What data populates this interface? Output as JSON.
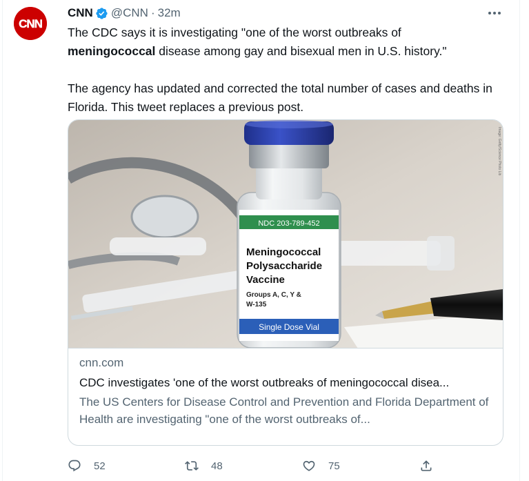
{
  "tweet": {
    "display_name": "CNN",
    "handle": "@CNN",
    "separator": "·",
    "time": "32m",
    "avatar_text": "CNN",
    "text_line1": "The CDC says it is investigating \"one of the worst outbreaks of",
    "text_highlight": "meningococcal",
    "text_line2_rest": " disease among gay and bisexual men in U.S. history.\"",
    "text_paragraph2": "The agency has updated and corrected the total number of cases and deaths in Florida. This tweet replaces a previous post."
  },
  "card": {
    "domain": "cnn.com",
    "title": "CDC investigates 'one of the worst outbreaks of meningococcal disea...",
    "description": "The US Centers for Disease Control and Prevention and Florida Department of Health are investigating \"one of the worst outbreaks of...",
    "image": {
      "ndc": "NDC 203-789-452",
      "label_line1": "Meningococcal",
      "label_line2": "Polysaccharide",
      "label_line3": "Vaccine",
      "groups_line1": "Groups A, C, Y &",
      "groups_line2": "W-135",
      "band_text": "Single Dose Vial",
      "credit": "Image: Getty/Science Photo Lib"
    }
  },
  "actions": {
    "reply_count": "52",
    "retweet_count": "48",
    "like_count": "75"
  },
  "colors": {
    "text": "#0f1419",
    "secondary": "#536471",
    "border": "#cfd9de",
    "verified": "#1d9bf0",
    "cnn_red": "#cc0000"
  }
}
